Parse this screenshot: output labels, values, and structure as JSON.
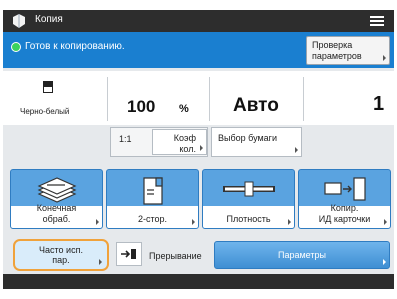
{
  "titlebar": {
    "title": "Копия",
    "icon": "copy-app-icon",
    "menu_icon": "hamburger-icon"
  },
  "status": {
    "text": "Готов к копированию.",
    "check_line1": "Проверка",
    "check_line2": "параметров"
  },
  "settings": {
    "color_mode": "Черно-белый",
    "zoom_value": "100",
    "zoom_unit": "%",
    "paper": "Авто",
    "copies": "1",
    "ratio_label": "1:1",
    "coef_line1": "Коэф",
    "coef_line2": "кол.",
    "paper_select": "Выбор бумаги"
  },
  "functions": [
    {
      "line1": "Конечная",
      "line2": "обраб.",
      "icon": "finishing-icon"
    },
    {
      "line1": "2-стор.",
      "line2": "",
      "icon": "two-sided-icon"
    },
    {
      "line1": "Плотность",
      "line2": "",
      "icon": "density-icon"
    },
    {
      "line1": "Копир.",
      "line2": "ИД карточки",
      "icon": "id-card-copy-icon"
    }
  ],
  "bottom": {
    "freq_line1": "Часто исп.",
    "freq_line2": "пар.",
    "interrupt": "Прерывание",
    "params": "Параметры"
  },
  "colors": {
    "accent": "#1a7fd0",
    "button": "#5aa3e0",
    "highlight": "#f0a23b",
    "ready": "#3bd35c"
  }
}
